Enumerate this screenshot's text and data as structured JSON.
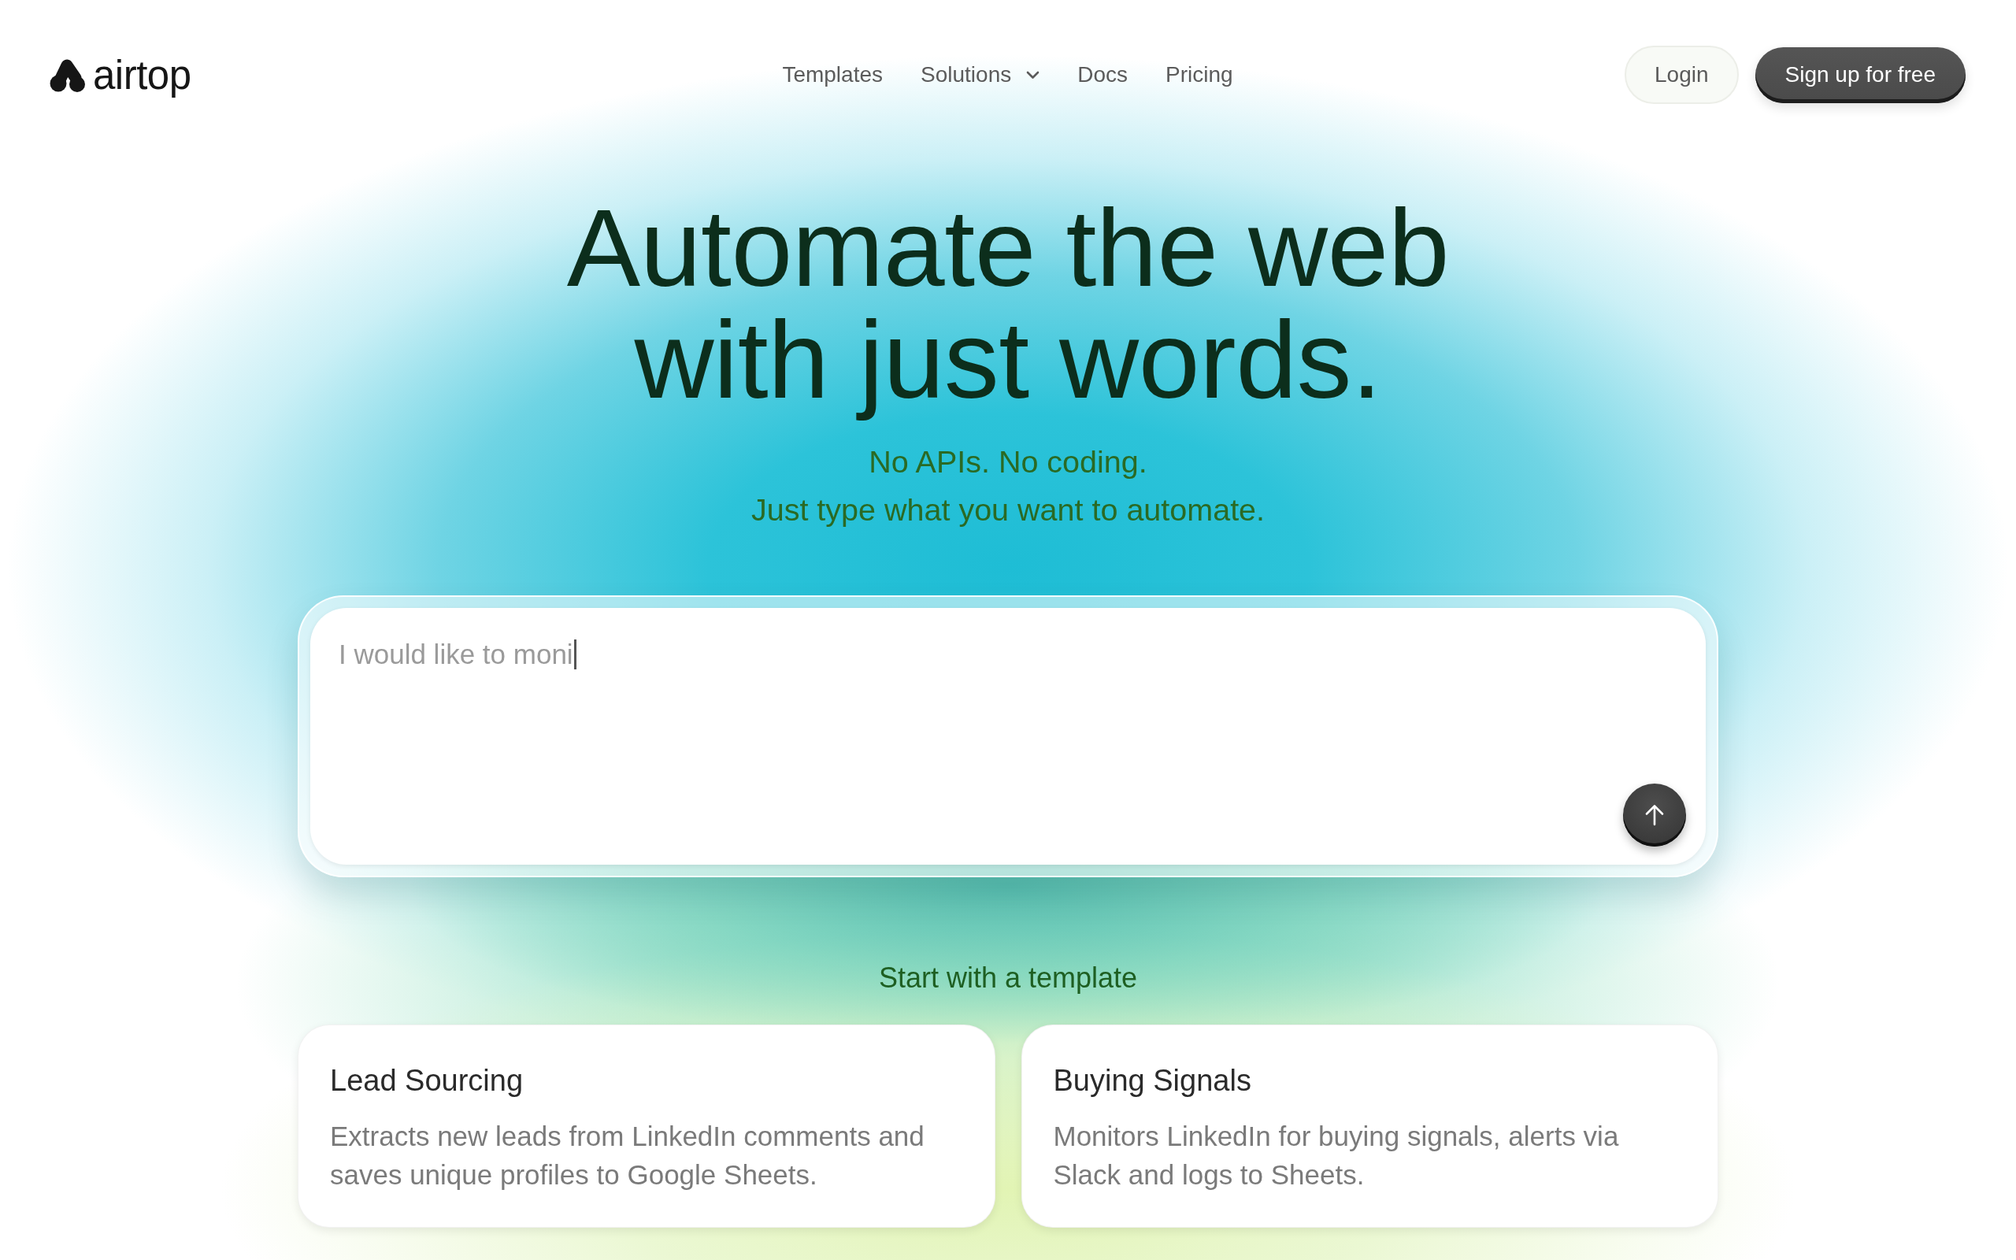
{
  "header": {
    "logo": {
      "text": "airtop"
    },
    "nav": [
      {
        "label": "Templates",
        "kind": "link"
      },
      {
        "label": "Solutions",
        "kind": "dropdown"
      },
      {
        "label": "Docs",
        "kind": "link"
      },
      {
        "label": "Pricing",
        "kind": "link"
      }
    ],
    "actions": [
      {
        "label": "Login",
        "kind": "secondary"
      },
      {
        "label": "Sign up for free",
        "kind": "primary"
      }
    ]
  },
  "hero": {
    "title_lines": [
      "Automate the web",
      "with just words."
    ],
    "subtitle_lines": [
      "No APIs. No coding.",
      "Just type what you want to automate."
    ]
  },
  "prompt": {
    "placeholder": "I would like to moni",
    "focused": true
  },
  "templates": {
    "heading": "Start with a template",
    "cards": [
      {
        "title": "Lead Sourcing",
        "description": "Extracts new leads from LinkedIn comments and saves unique profiles to Google Sheets."
      },
      {
        "title": "Buying Signals",
        "description": "Monitors LinkedIn for buying signals, alerts via Slack and logs to Sheets."
      }
    ]
  }
}
